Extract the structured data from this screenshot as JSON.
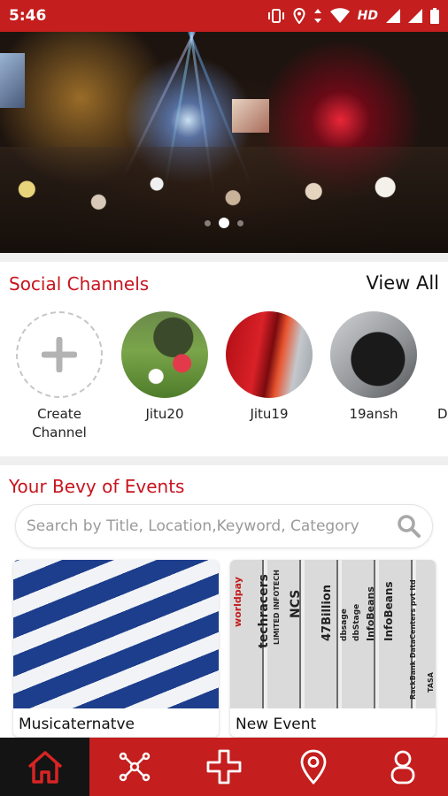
{
  "status_bar": {
    "time": "5:46",
    "network_label": "HD",
    "icons": [
      "vibrate-icon",
      "location-icon",
      "data-arrows-icon",
      "wifi-icon",
      "signal-icon",
      "signal-icon",
      "battery-icon"
    ]
  },
  "hero_carousel": {
    "slide_count": 3,
    "active_index": 1
  },
  "social_channels": {
    "title": "Social Channels",
    "view_all_label": "View All",
    "create_label_line1": "Create",
    "create_label_line2": "Channel",
    "channels": [
      {
        "name": "Jitu20"
      },
      {
        "name": "Jitu19"
      },
      {
        "name": "19ansh"
      },
      {
        "name": "D"
      }
    ]
  },
  "events": {
    "title": "Your Bevy of Events",
    "search_placeholder": "Search by Title, Location,Keyword, Category",
    "cards": [
      {
        "title": "Musicaternatve"
      },
      {
        "title": "New Event",
        "image_text": [
          "worldpay",
          "techracers",
          "LIMITED INFOTECH",
          "NCS",
          "47Billion",
          "dbsage",
          "dbStage",
          "InfoBeans",
          "InfoBeans",
          "RackBank DataCenters pvt ltd",
          "TASA"
        ]
      }
    ]
  },
  "bottom_nav": {
    "items": [
      "home-icon",
      "network-icon",
      "add-icon",
      "location-pin-icon",
      "profile-icon"
    ],
    "active": 0
  },
  "colors": {
    "brand_red": "#c41e1e",
    "title_red": "#c8141e",
    "active_nav_bg": "#141414"
  }
}
